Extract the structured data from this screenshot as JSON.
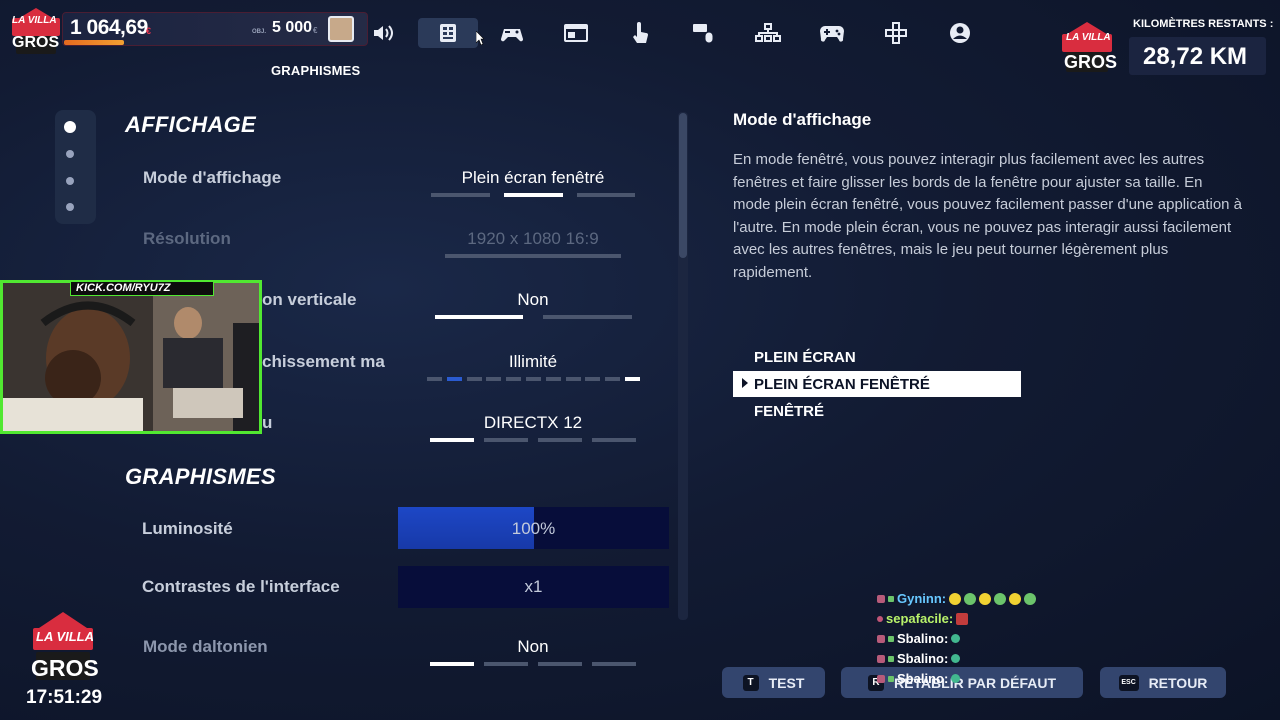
{
  "brand": {
    "logo_top": "LA VILLA",
    "logo_mid": "DES",
    "logo_bottom": "GROS"
  },
  "money": {
    "amount": "1 064,69",
    "currency": "€",
    "goal_label": "OBJ.",
    "goal_amount": "5 000",
    "goal_currency": "€",
    "progress": 0.21
  },
  "nav": {
    "active_label": "GRAPHISMES",
    "items": [
      {
        "icon": "volume-icon"
      },
      {
        "icon": "display-settings-icon"
      },
      {
        "icon": "gamepad-settings-icon"
      },
      {
        "icon": "window-icon"
      },
      {
        "icon": "touch-icon"
      },
      {
        "icon": "keyboard-mouse-icon"
      },
      {
        "icon": "network-icon"
      },
      {
        "icon": "controller-icon"
      },
      {
        "icon": "dpad-icon"
      },
      {
        "icon": "account-icon"
      }
    ]
  },
  "km": {
    "label": "KILOMÈTRES RESTANTS :",
    "value": "28,72 KM"
  },
  "settings": {
    "section_display": "AFFICHAGE",
    "section_graphics": "GRAPHISMES",
    "rows": {
      "mode": {
        "label": "Mode d'affichage",
        "value": "Plein écran fenêtré"
      },
      "resolution": {
        "label": "Résolution",
        "value": "1920 x 1080 16:9"
      },
      "vsync": {
        "label": "on verticale",
        "value": "Non"
      },
      "refresh": {
        "label": "chissement ma",
        "value": "Illimité"
      },
      "api": {
        "label": "u",
        "value": "DIRECTX 12"
      },
      "brightness": {
        "label": "Luminosité",
        "value": "100%",
        "level": 0.5
      },
      "contrast": {
        "label": "Contrastes de l'interface",
        "value": "x1"
      },
      "colorblind": {
        "label": "Mode daltonien",
        "value": "Non"
      }
    }
  },
  "webcam": {
    "tag": "KICK.COM/RYU7Z"
  },
  "description": {
    "title": "Mode d'affichage",
    "body": "En mode fenêtré, vous pouvez interagir plus facilement avec les autres fenêtres et faire glisser les bords de la fenêtre pour ajuster sa taille. En mode plein écran fenêtré, vous pouvez facilement passer d'une application à l'autre. En mode plein écran, vous ne pouvez pas interagir aussi facilement avec les autres fenêtres, mais le jeu peut tourner légèrement plus rapidement.",
    "options": [
      "PLEIN ÉCRAN",
      "PLEIN ÉCRAN FENÊTRÉ",
      "FENÊTRÉ"
    ],
    "selected_index": 1
  },
  "chat": [
    {
      "user": "Gyninn:",
      "color": "#68c8ff"
    },
    {
      "user": "sepafacile:",
      "color": "#b8f26a"
    },
    {
      "user": "Sbalino:",
      "color": "#ffffff"
    },
    {
      "user": "Sbalino:",
      "color": "#ffffff"
    },
    {
      "user": "Sbalino:",
      "color": "#ffffff"
    }
  ],
  "buttons": {
    "test": {
      "key": "T",
      "label": "TEST"
    },
    "reset": {
      "key": "R",
      "label": "RÉTABLIR PAR DÉFAUT"
    },
    "back": {
      "key": "ESC",
      "label": "RETOUR"
    }
  },
  "clock": "17:51:29",
  "colors": {
    "accent_blue": "#1d47c6",
    "webcam_green": "#51e831",
    "currency_red": "#e53550"
  }
}
